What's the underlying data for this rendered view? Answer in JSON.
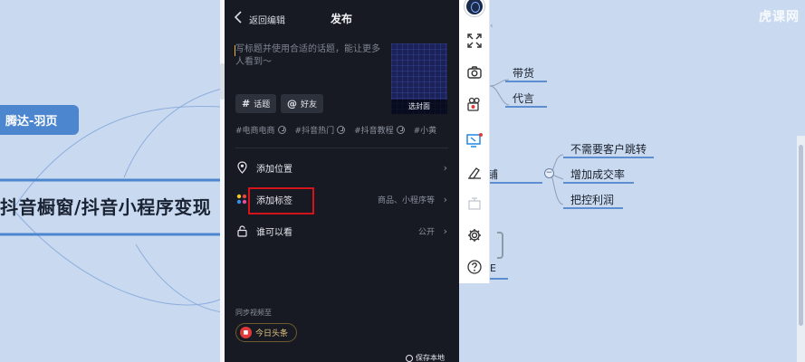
{
  "mindmap": {
    "left_chip": "腾达-羽页",
    "big_label": "抖音橱窗/抖音小程序变现",
    "nodes_upper": [
      "带货",
      "代言"
    ],
    "center_partial": "自主店铺",
    "nodes_right": [
      "不需要客户跳转",
      "增加成交率",
      "把控利润"
    ],
    "partial_small": "E",
    "collapse_symbol": "−",
    "watermark": "虎课网",
    "accent": "#5d8fd0"
  },
  "phone": {
    "back_label": "返回编辑",
    "title": "发布",
    "caption_placeholder": "写标题并使用合适的话题，能让更多人看到～",
    "cover_label": "选封面",
    "pills": [
      {
        "symbol": "#",
        "label": "话题"
      },
      {
        "symbol": "@",
        "label": "好友"
      }
    ],
    "hashtags": [
      "#电商电商",
      "#抖音热门",
      "#抖音教程",
      "#小黄"
    ],
    "rows": [
      {
        "icon": "location-icon",
        "label": "添加位置",
        "value": ""
      },
      {
        "icon": "tag-grid-icon",
        "label": "添加标签",
        "value": "商品、小程序等"
      },
      {
        "icon": "lock-icon",
        "label": "谁可以看",
        "value": "公开"
      }
    ],
    "sync_label": "同步视频至",
    "toutiao_label": "今日头条",
    "save_local": "保存本地",
    "highlight_color": "#d3141b"
  },
  "toolbar": {
    "buttons": [
      "avatar-icon",
      "fullscreen-icon",
      "camera-icon",
      "video-record-icon",
      "screen-cast-icon",
      "eraser-icon",
      "whiteboard-icon",
      "settings-icon",
      "help-icon"
    ],
    "collapse_glyph": "‹"
  }
}
